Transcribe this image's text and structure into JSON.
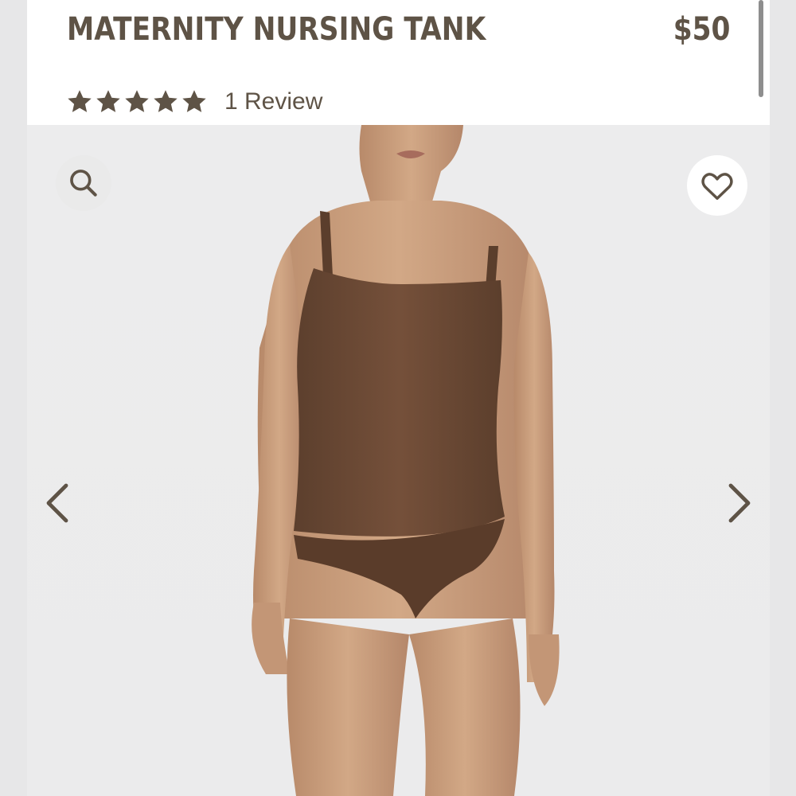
{
  "product": {
    "title": "MATERNITY NURSING TANK",
    "price": "$50",
    "rating_stars": 5,
    "review_label": "1 Review"
  },
  "gallery": {
    "image_alt": "Model wearing brown maternity nursing tank and matching briefs",
    "icons": {
      "search": "search-icon",
      "wishlist": "heart-icon",
      "prev": "chevron-left-icon",
      "next": "chevron-right-icon"
    }
  },
  "colors": {
    "text": "#5e5346",
    "header_bg": "#ffffff",
    "gallery_bg": "#ececed",
    "garment": "#6b4a35",
    "skin": "#c89d7c"
  }
}
